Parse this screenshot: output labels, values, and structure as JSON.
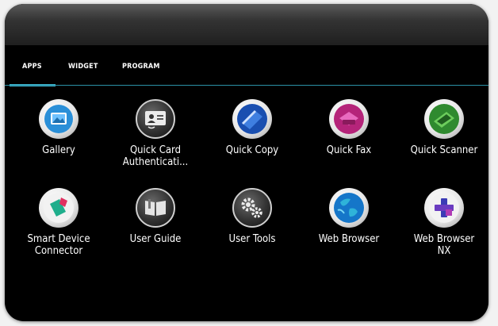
{
  "tabs": [
    "APPS",
    "WIDGET",
    "PROGRAM"
  ],
  "active_tab": "APPS",
  "apps": [
    {
      "label": "Gallery",
      "icon": "gallery-icon"
    },
    {
      "label": "Quick Card\nAuthenticati...",
      "icon": "id-card-icon"
    },
    {
      "label": "Quick Copy",
      "icon": "copy-icon"
    },
    {
      "label": "Quick Fax",
      "icon": "fax-icon"
    },
    {
      "label": "Quick Scanner",
      "icon": "scanner-icon"
    },
    {
      "label": "Smart Device\nConnector",
      "icon": "smart-device-icon"
    },
    {
      "label": "User Guide",
      "icon": "book-icon"
    },
    {
      "label": "User Tools",
      "icon": "gears-icon"
    },
    {
      "label": "Web Browser",
      "icon": "globe-icon"
    },
    {
      "label": "Web Browser\nNX",
      "icon": "browser-nx-icon"
    }
  ],
  "colors": {
    "accent": "#3fb6cf"
  }
}
